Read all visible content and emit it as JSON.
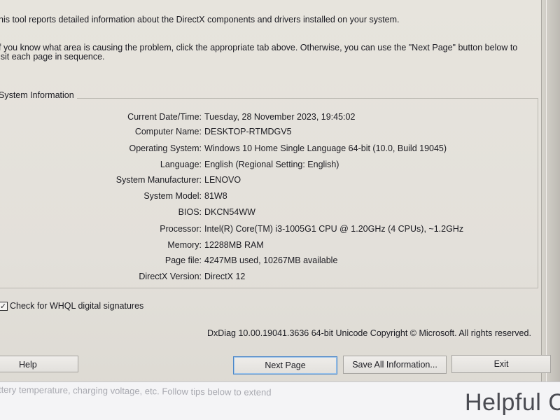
{
  "intro": {
    "line1": "his tool reports detailed information about the DirectX components and drivers installed on your system.",
    "line2": "f you know what area is causing the problem, click the appropriate tab above.  Otherwise, you can use the \"Next Page\" button below to",
    "line3": "isit each page in sequence."
  },
  "system_info": {
    "title": "System Information",
    "rows": [
      {
        "label": "Current Date/Time:",
        "value": "Tuesday, 28 November 2023, 19:45:02"
      },
      {
        "label": "Computer Name:",
        "value": "DESKTOP-RTMDGV5"
      },
      {
        "label": "Operating System:",
        "value": "Windows 10 Home Single Language 64-bit (10.0, Build 19045)"
      },
      {
        "label": "Language:",
        "value": "English (Regional Setting: English)"
      },
      {
        "label": "System Manufacturer:",
        "value": "LENOVO"
      },
      {
        "label": "System Model:",
        "value": "81W8"
      },
      {
        "label": "BIOS:",
        "value": "DKCN54WW"
      },
      {
        "label": "Processor:",
        "value": "Intel(R) Core(TM) i3-1005G1 CPU @ 1.20GHz (4 CPUs), ~1.2GHz"
      },
      {
        "label": "Memory:",
        "value": "12288MB RAM"
      },
      {
        "label": "Page file:",
        "value": "4247MB used, 10267MB available"
      },
      {
        "label": "DirectX Version:",
        "value": "DirectX 12"
      }
    ]
  },
  "whql": {
    "label": "Check for WHQL digital signatures",
    "checked": true,
    "check_glyph": "✓"
  },
  "copyright": "DxDiag 10.00.19041.3636 64-bit Unicode  Copyright © Microsoft. All rights reserved.",
  "buttons": {
    "help": "Help",
    "next_page": "Next Page",
    "save_all": "Save All Information...",
    "exit": "Exit"
  },
  "background_page": {
    "faded_text": "ttery temperature, charging voltage, etc. Follow tips below to extend",
    "heading": "Helpful C"
  }
}
